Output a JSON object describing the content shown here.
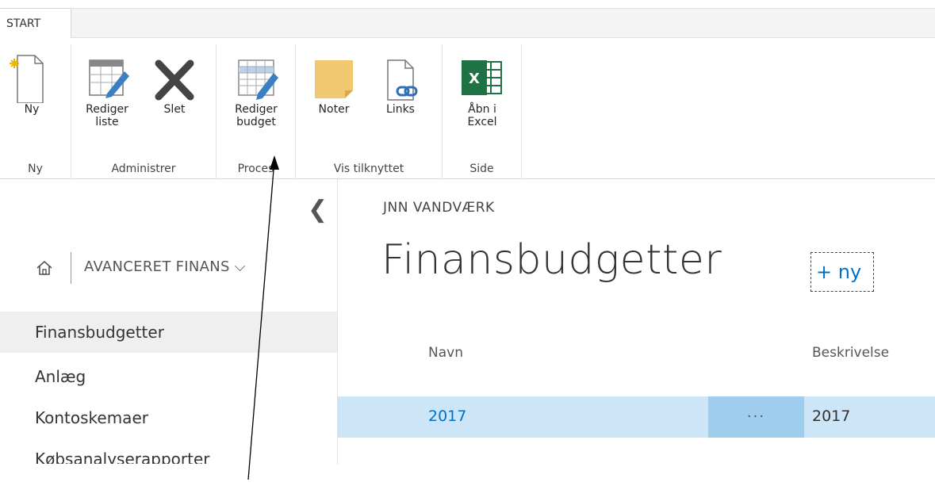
{
  "ribbon": {
    "tab_start": "START",
    "groups": {
      "ny": {
        "label": "Ny",
        "new_button": "Ny"
      },
      "administrer": {
        "label": "Administrer",
        "edit_list": "Rediger\nliste",
        "delete": "Slet"
      },
      "proces": {
        "label": "Proces",
        "edit_budget": "Rediger\nbudget"
      },
      "vis_tilknyttet": {
        "label": "Vis tilknyttet",
        "notes": "Noter",
        "links": "Links"
      },
      "side": {
        "label": "Side",
        "open_excel": "Åbn i\nExcel"
      }
    }
  },
  "nav": {
    "collapse_glyph": "❮",
    "site_name": "AVANCERET FINANS ⌵",
    "items": [
      {
        "label": "Finansbudgetter"
      },
      {
        "label": "Anlæg"
      },
      {
        "label": "Kontoskemaer"
      },
      {
        "label": "Købsanalyserapporter"
      }
    ]
  },
  "main": {
    "breadcrumb": "JNN VANDVÆRK",
    "title": "Finansbudgetter",
    "new_label": "+ ny",
    "columns": {
      "navn": "Navn",
      "beskrivelse": "Beskrivelse"
    },
    "rows": [
      {
        "navn": "2017",
        "more": "···",
        "beskrivelse": "2017"
      }
    ]
  },
  "colors": {
    "accent": "#0072c6",
    "row_selected": "#cde6f7",
    "excel_green": "#1f7244",
    "notes_yellow": "#f1c86f"
  }
}
